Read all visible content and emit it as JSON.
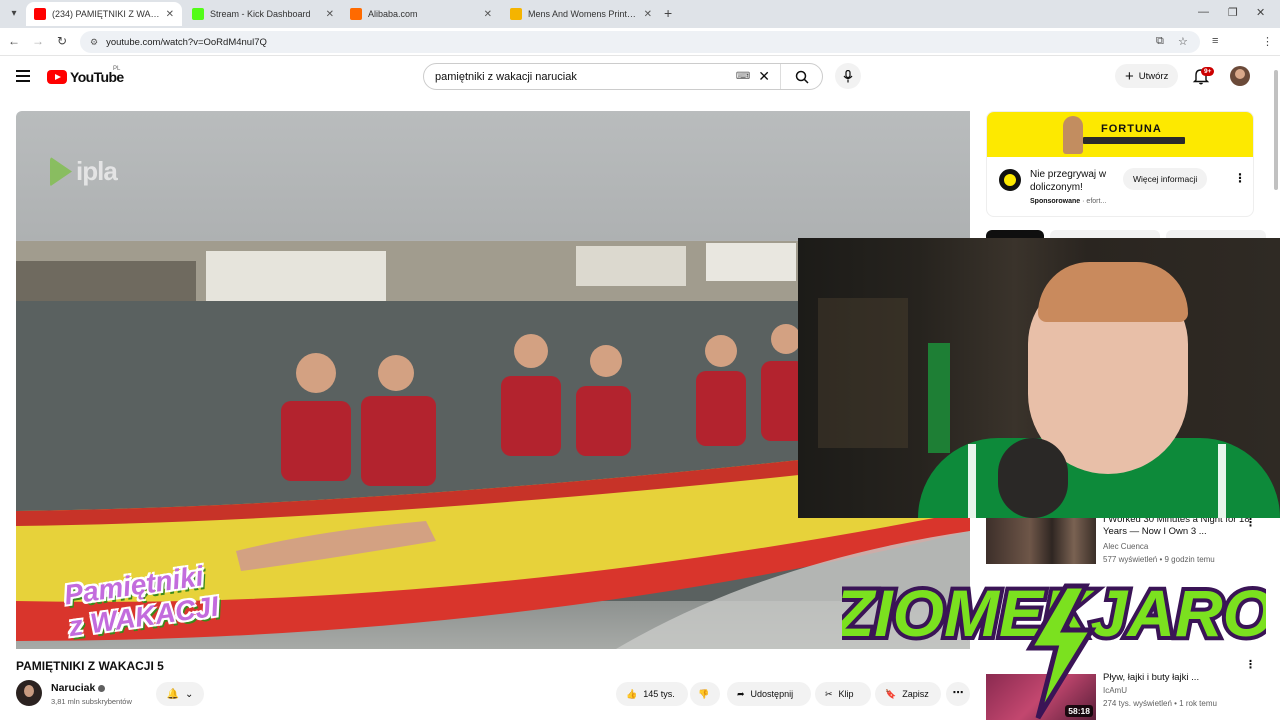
{
  "browser": {
    "tabs": [
      {
        "label": "(234) PAMIĘTNIKI Z WAKACJI 5",
        "color": "#ff0000",
        "active": true
      },
      {
        "label": "Stream - Kick Dashboard",
        "color": "#53fc18",
        "active": false
      },
      {
        "label": "Alibaba.com",
        "color": "#ff6a00",
        "active": false
      },
      {
        "label": "Mens And Womens Print On D...",
        "color": "#f5b400",
        "active": false
      }
    ],
    "url": "youtube.com/watch?v=OoRdM4nul7Q"
  },
  "header": {
    "logo_text": "YouTube",
    "region": "PL",
    "search_value": "pamiętniki z wakacji naruciak",
    "create_label": "Utwórz",
    "notification_count": "9+"
  },
  "player": {
    "watermark": "ipla",
    "show_logo_line1": "Pamiętniki",
    "show_logo_line2": "z WAKACJI"
  },
  "video": {
    "title": "PAMIĘTNIKI Z WAKACJI 5",
    "channel": "Naruciak",
    "subscribers": "3,81 mln subskrybentów",
    "likes": "145 tys.",
    "share_label": "Udostępnij",
    "clip_label": "Klip",
    "save_label": "Zapisz"
  },
  "ad": {
    "brand": "FORTUNA",
    "headline": "Nie przegrywaj w doliczonym!",
    "sponsored": "Sponsorowane",
    "domain": "efort...",
    "button": "Więcej informacji"
  },
  "related": [
    {
      "title": "I Worked 30 Minutes a Night for 18 Years — Now I Own 3 ...",
      "channel": "Alec Cuenca",
      "meta": "577 wyświetleń • 9 godzin temu"
    },
    {
      "title": "Pływ, łajki i buty łajki ...",
      "channel": "IcAmU",
      "meta": "274 tys. wyświetleń • 1 rok temu",
      "duration": "58:18"
    }
  ],
  "overlay": {
    "streamer_logo": "ZIOMEKJARO"
  },
  "colors": {
    "youtube_red": "#ff0000",
    "ad_yellow": "#fde900",
    "logo_green": "#7be11f",
    "logo_purple": "#8a2be2"
  }
}
